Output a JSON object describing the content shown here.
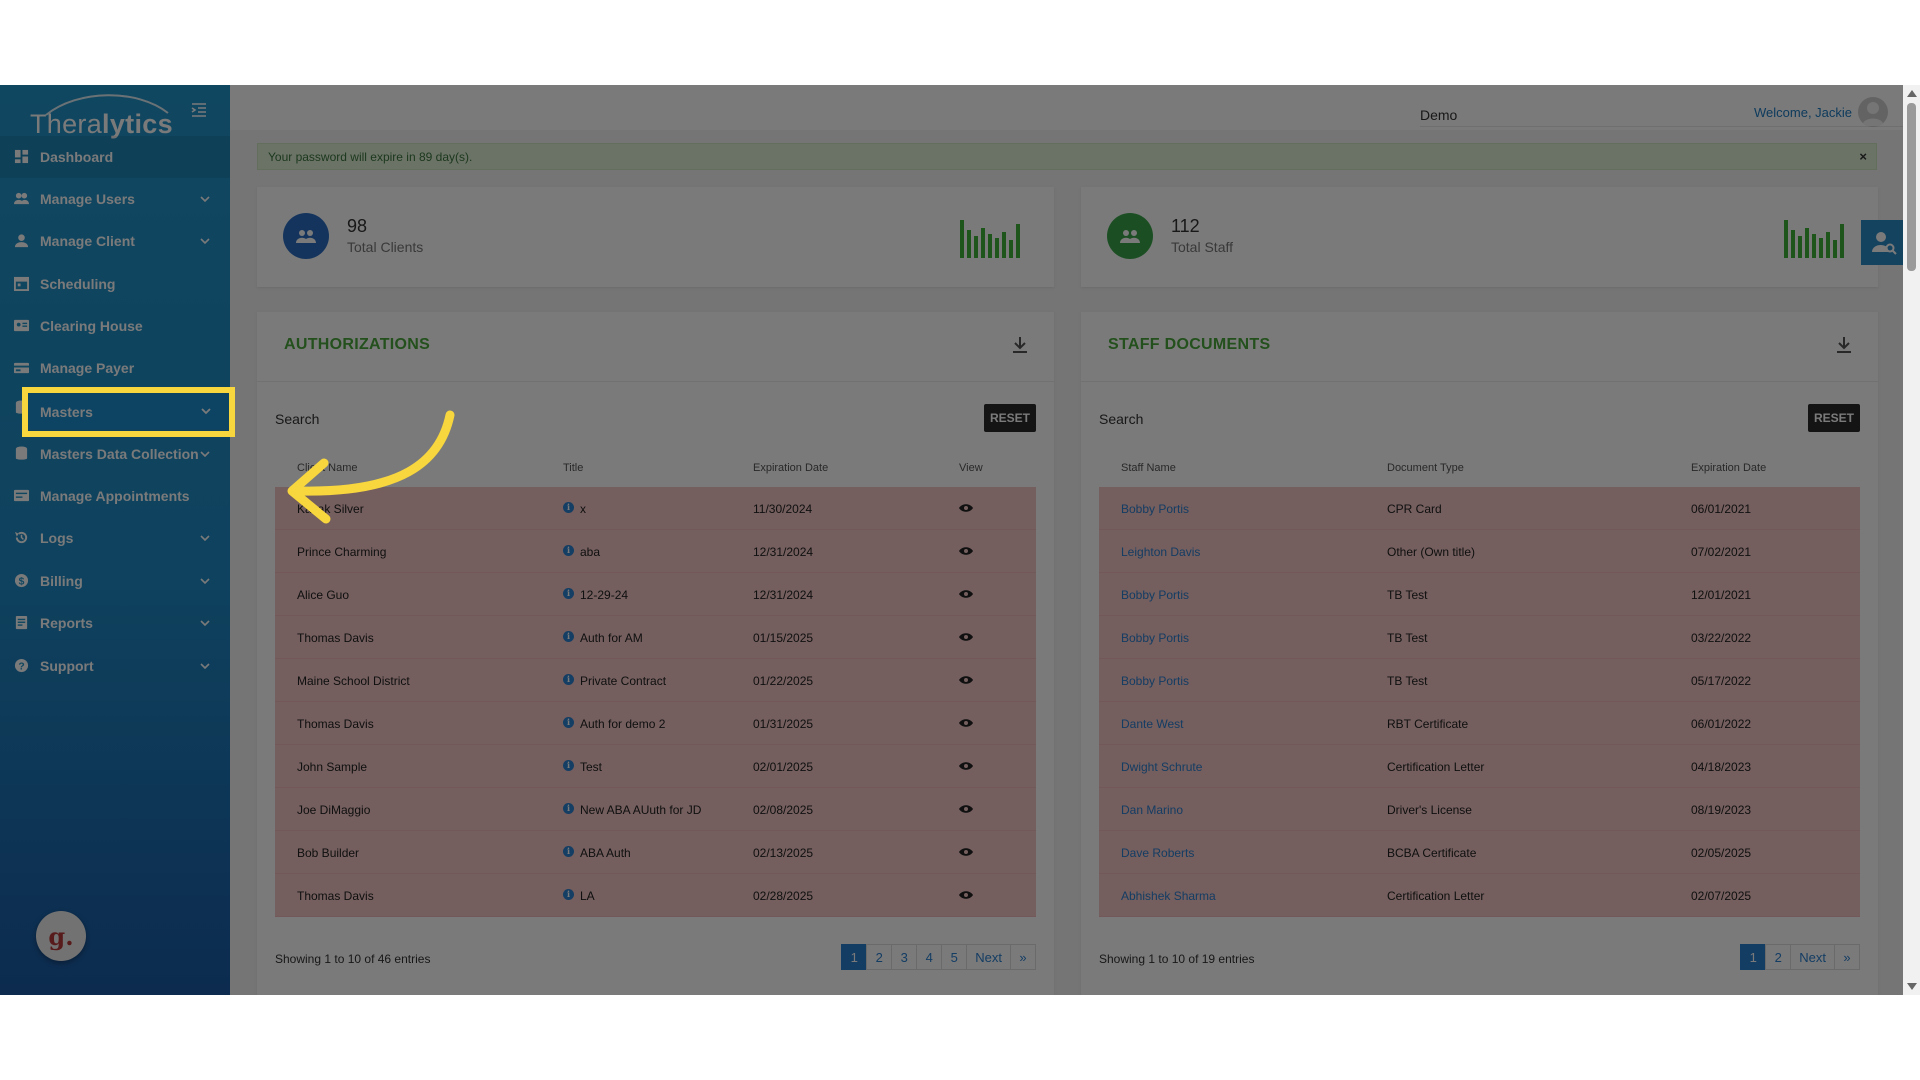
{
  "app": {
    "logo_prefix": "Thera",
    "logo_suffix": "lytics",
    "org_selected": "Demo",
    "welcome": "Welcome, Jackie",
    "help_badge": "g."
  },
  "sidebar": {
    "items": [
      {
        "label": "Dashboard",
        "icon": "dashboard-icon"
      },
      {
        "label": "Manage Users",
        "icon": "users-icon"
      },
      {
        "label": "Manage Client",
        "icon": "client-icon"
      },
      {
        "label": "Scheduling",
        "icon": "calendar-icon"
      },
      {
        "label": "Clearing House",
        "icon": "id-card-icon"
      },
      {
        "label": "Manage Payer",
        "icon": "payer-icon"
      },
      {
        "label": "Masters",
        "icon": "database-icon"
      },
      {
        "label": "Masters Data Collection",
        "icon": "database-icon"
      },
      {
        "label": "Manage Appointments",
        "icon": "appointments-icon"
      },
      {
        "label": "Logs",
        "icon": "history-icon"
      },
      {
        "label": "Billing",
        "icon": "dollar-icon"
      },
      {
        "label": "Reports",
        "icon": "report-icon"
      },
      {
        "label": "Support",
        "icon": "help-icon"
      }
    ]
  },
  "alert": {
    "message": "Your password will expire in 89 day(s).",
    "close": "×"
  },
  "stats": {
    "clients": {
      "value": "98",
      "label": "Total Clients"
    },
    "staff": {
      "value": "112",
      "label": "Total Staff"
    }
  },
  "authorizations": {
    "title": "AUTHORIZATIONS",
    "search_label": "Search",
    "reset": "RESET",
    "headers": [
      "Client Name",
      "Title",
      "Expiration Date",
      "View"
    ],
    "rows": [
      [
        "Kazak Silver",
        "x",
        "11/30/2024"
      ],
      [
        "Prince Charming",
        "aba",
        "12/31/2024"
      ],
      [
        "Alice Guo",
        "12-29-24",
        "12/31/2024"
      ],
      [
        "Thomas Davis",
        "Auth for AM",
        "01/15/2025"
      ],
      [
        "Maine School District",
        "Private Contract",
        "01/22/2025"
      ],
      [
        "Thomas Davis",
        "Auth for demo 2",
        "01/31/2025"
      ],
      [
        "John Sample",
        "Test",
        "02/01/2025"
      ],
      [
        "Joe DiMaggio",
        "New ABA AUuth for JD",
        "02/08/2025"
      ],
      [
        "Bob Builder",
        "ABA Auth",
        "02/13/2025"
      ],
      [
        "Thomas Davis",
        "LA",
        "02/28/2025"
      ]
    ],
    "showing": "Showing 1 to 10 of 46 entries",
    "pages": [
      "1",
      "2",
      "3",
      "4",
      "5",
      "Next",
      "»"
    ]
  },
  "staff_documents": {
    "title": "STAFF DOCUMENTS",
    "search_label": "Search",
    "reset": "RESET",
    "headers": [
      "Staff Name",
      "Document Type",
      "Expiration Date"
    ],
    "rows": [
      [
        "Bobby Portis",
        "CPR Card",
        "06/01/2021"
      ],
      [
        "Leighton Davis",
        "Other (Own title)",
        "07/02/2021"
      ],
      [
        "Bobby Portis",
        "TB Test",
        "12/01/2021"
      ],
      [
        "Bobby Portis",
        "TB Test",
        "03/22/2022"
      ],
      [
        "Bobby Portis",
        "TB Test",
        "05/17/2022"
      ],
      [
        "Dante West",
        "RBT Certificate",
        "06/01/2022"
      ],
      [
        "Dwight Schrute",
        "Certification Letter",
        "04/18/2023"
      ],
      [
        "Dan Marino",
        "Driver's License",
        "08/19/2023"
      ],
      [
        "Dave Roberts",
        "BCBA Certificate",
        "02/05/2025"
      ],
      [
        "Abhishek Sharma",
        "Certification Letter",
        "02/07/2025"
      ]
    ],
    "showing": "Showing 1 to 10 of 19 entries",
    "pages": [
      "1",
      "2",
      "Next",
      "»"
    ]
  },
  "colors": {
    "sidebar_top": "#2394c9",
    "sidebar_bottom": "#1b5aa5",
    "accent_green": "#4aa83b",
    "highlight_yellow": "#f8d63e",
    "row_expired": "#f3c4c4"
  }
}
